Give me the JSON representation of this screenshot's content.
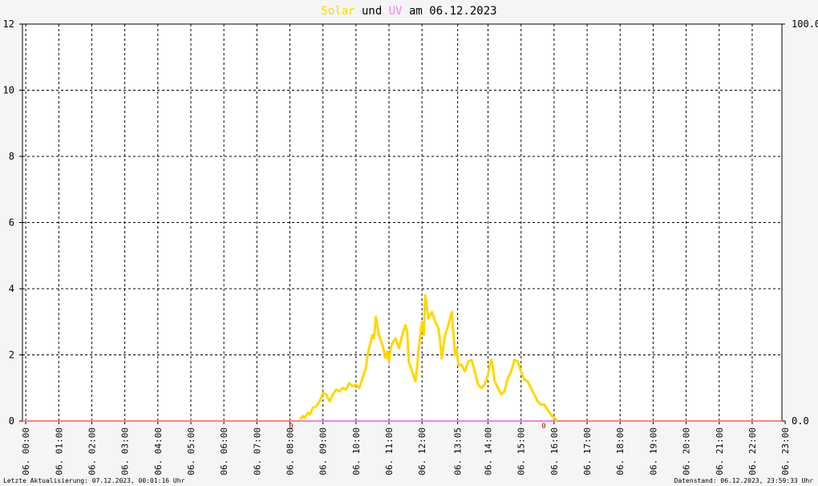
{
  "title": {
    "part1": "Solar",
    "part2": " und ",
    "part3": "UV",
    "part4": " am 06.12.2023",
    "color_solar": "#ffd700",
    "color_uv": "#ee82ee",
    "color_text": "#000000"
  },
  "footer": {
    "left": "Letzte Aktualisierung: 07.12.2023, 00:01:16 Uhr",
    "right": "Datenstand: 06.12.2023, 23:59:33 Uhr"
  },
  "markers": {
    "sunrise": "0",
    "sunset": "0",
    "color": "#cc0000"
  },
  "chart_data": {
    "type": "line",
    "x_unit": "hours since 00:00 on 06.12.2023",
    "xlim": [
      -0.1,
      22.9
    ],
    "left_axis": {
      "ylim": [
        0,
        12
      ],
      "ticks": [
        0,
        2,
        4,
        6,
        8,
        10,
        12
      ]
    },
    "right_axis": {
      "ylim": [
        0,
        100
      ],
      "tick_labels": [
        "0.0",
        "100.0"
      ]
    },
    "x_tick_labels": [
      "06. 00:00",
      "06. 01:00",
      "06. 02:00",
      "06. 03:00",
      "06. 04:00",
      "06. 05:00",
      "06. 06:00",
      "06. 07:00",
      "06. 08:00",
      "06. 09:00",
      "06. 10:00",
      "06. 11:00",
      "06. 12:00",
      "06. 13:05",
      "06. 14:00",
      "06. 15:00",
      "06. 16:00",
      "06. 17:00",
      "06. 18:00",
      "06. 19:00",
      "06. 20:00",
      "06. 21:00",
      "06. 22:00",
      "06. 23:00"
    ],
    "x_tick_values": [
      0,
      1,
      2,
      3,
      4,
      5,
      6,
      7,
      8,
      9,
      10,
      11,
      12,
      13.08,
      14,
      15,
      16,
      17,
      18,
      19,
      20,
      21,
      22,
      23
    ],
    "grid": true,
    "series": [
      {
        "name": "Solar",
        "color": "#ffd700",
        "axis": "left",
        "x": [
          8.3,
          8.4,
          8.45,
          8.55,
          8.6,
          8.7,
          8.8,
          8.9,
          9.0,
          9.1,
          9.2,
          9.3,
          9.4,
          9.5,
          9.6,
          9.7,
          9.8,
          9.9,
          10.0,
          10.1,
          10.2,
          10.3,
          10.35,
          10.45,
          10.5,
          10.55,
          10.6,
          10.7,
          10.8,
          10.9,
          10.95,
          11.0,
          11.05,
          11.1,
          11.2,
          11.3,
          11.4,
          11.5,
          11.55,
          11.6,
          11.7,
          11.8,
          11.85,
          11.9,
          12.0,
          12.05,
          12.1,
          12.15,
          12.2,
          12.3,
          12.4,
          12.5,
          12.55,
          12.6,
          12.7,
          12.8,
          12.9,
          13.0,
          13.05,
          13.1,
          13.2,
          13.3,
          13.4,
          13.5,
          13.6,
          13.7,
          13.8,
          13.9,
          14.0,
          14.05,
          14.1,
          14.15,
          14.2,
          14.3,
          14.4,
          14.5,
          14.6,
          14.7,
          14.8,
          14.9,
          15.0,
          15.1,
          15.2,
          15.3,
          15.4,
          15.5,
          15.6,
          15.7,
          15.8,
          15.9,
          16.0,
          16.05,
          16.1
        ],
        "y": [
          0.05,
          0.15,
          0.1,
          0.25,
          0.2,
          0.4,
          0.45,
          0.6,
          0.85,
          0.8,
          0.6,
          0.8,
          0.95,
          0.9,
          1.0,
          0.95,
          1.15,
          1.05,
          1.1,
          1.0,
          1.3,
          1.6,
          2.0,
          2.4,
          2.6,
          2.5,
          3.15,
          2.6,
          2.3,
          1.9,
          2.1,
          1.8,
          2.2,
          2.35,
          2.5,
          2.2,
          2.6,
          2.9,
          2.7,
          1.8,
          1.5,
          1.2,
          1.6,
          2.2,
          3.0,
          2.6,
          3.8,
          3.4,
          3.1,
          3.3,
          3.0,
          2.8,
          2.4,
          1.9,
          2.6,
          2.9,
          3.3,
          2.0,
          2.2,
          1.7,
          1.7,
          1.5,
          1.8,
          1.85,
          1.5,
          1.1,
          1.0,
          1.1,
          1.4,
          1.7,
          1.85,
          1.6,
          1.2,
          1.0,
          0.8,
          0.9,
          1.3,
          1.5,
          1.85,
          1.8,
          1.5,
          1.25,
          1.2,
          1.0,
          0.8,
          0.6,
          0.5,
          0.5,
          0.35,
          0.2,
          0.1,
          0.05,
          0.0
        ]
      },
      {
        "name": "UV",
        "color": "#ee82ee",
        "axis": "left",
        "x": [
          8.3,
          16.1
        ],
        "y": [
          0,
          0
        ]
      },
      {
        "name": "baseline",
        "color": "#ff8080",
        "axis": "left",
        "x": [
          -0.1,
          22.9
        ],
        "y": [
          0,
          0
        ]
      }
    ]
  }
}
